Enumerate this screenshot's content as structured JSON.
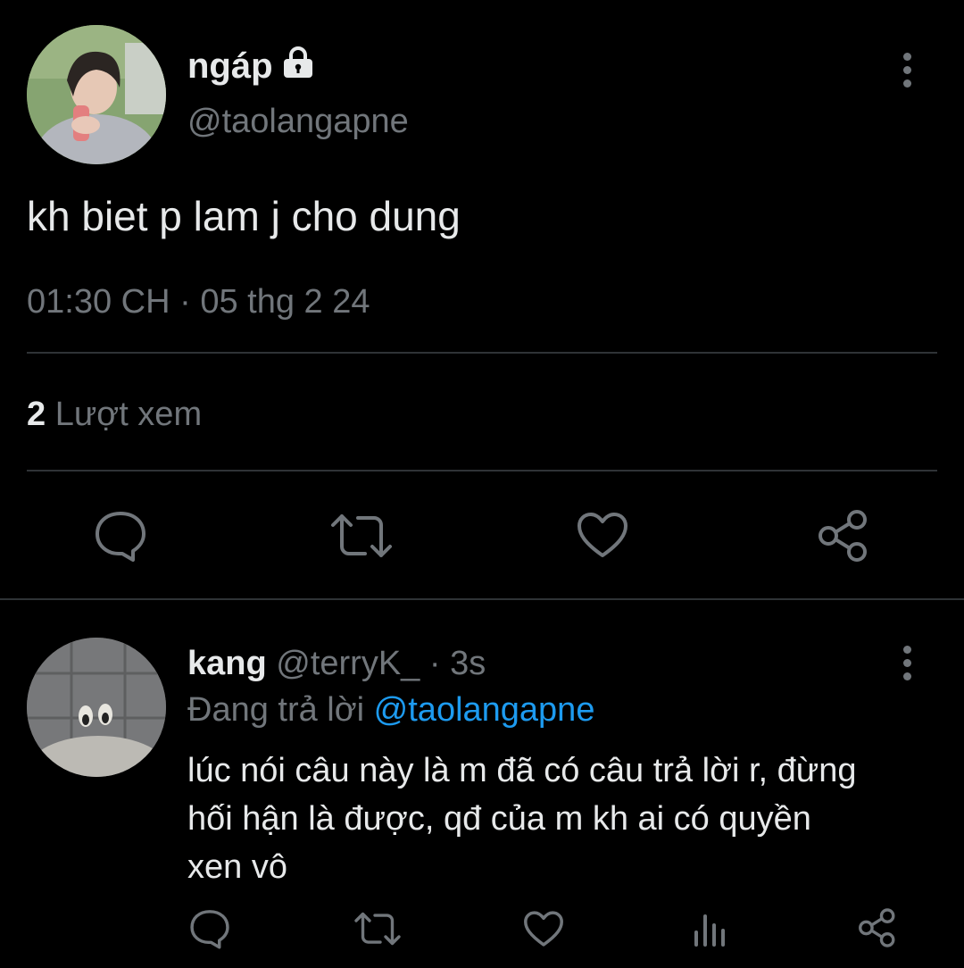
{
  "main_tweet": {
    "display_name": "ngáp",
    "handle": "@taolangapne",
    "text": "kh biet p lam j cho dung",
    "timestamp": "01:30 CH",
    "separator": "·",
    "date": "05 thg 2 24",
    "views_count": "2",
    "views_label": "Lượt xem",
    "locked": true
  },
  "reply": {
    "display_name": "kang",
    "handle": "@terryK_",
    "separator": "·",
    "age": "3s",
    "replying_prefix": "Đang trả lời",
    "replying_to": "@taolangapne",
    "text_line1": "lúc nói câu này là m đã có câu trả lời r, đừng",
    "text_line2": "hối hận là được, qđ của m kh ai có quyền",
    "text_line3": "xen vô"
  },
  "colors": {
    "background": "#000000",
    "text": "#e7e9ea",
    "secondary": "#71767b",
    "link": "#1d9bf0",
    "divider": "#2f3336"
  },
  "icons": [
    "lock-icon",
    "more-icon",
    "reply-icon",
    "retweet-icon",
    "like-icon",
    "share-icon",
    "views-icon"
  ]
}
